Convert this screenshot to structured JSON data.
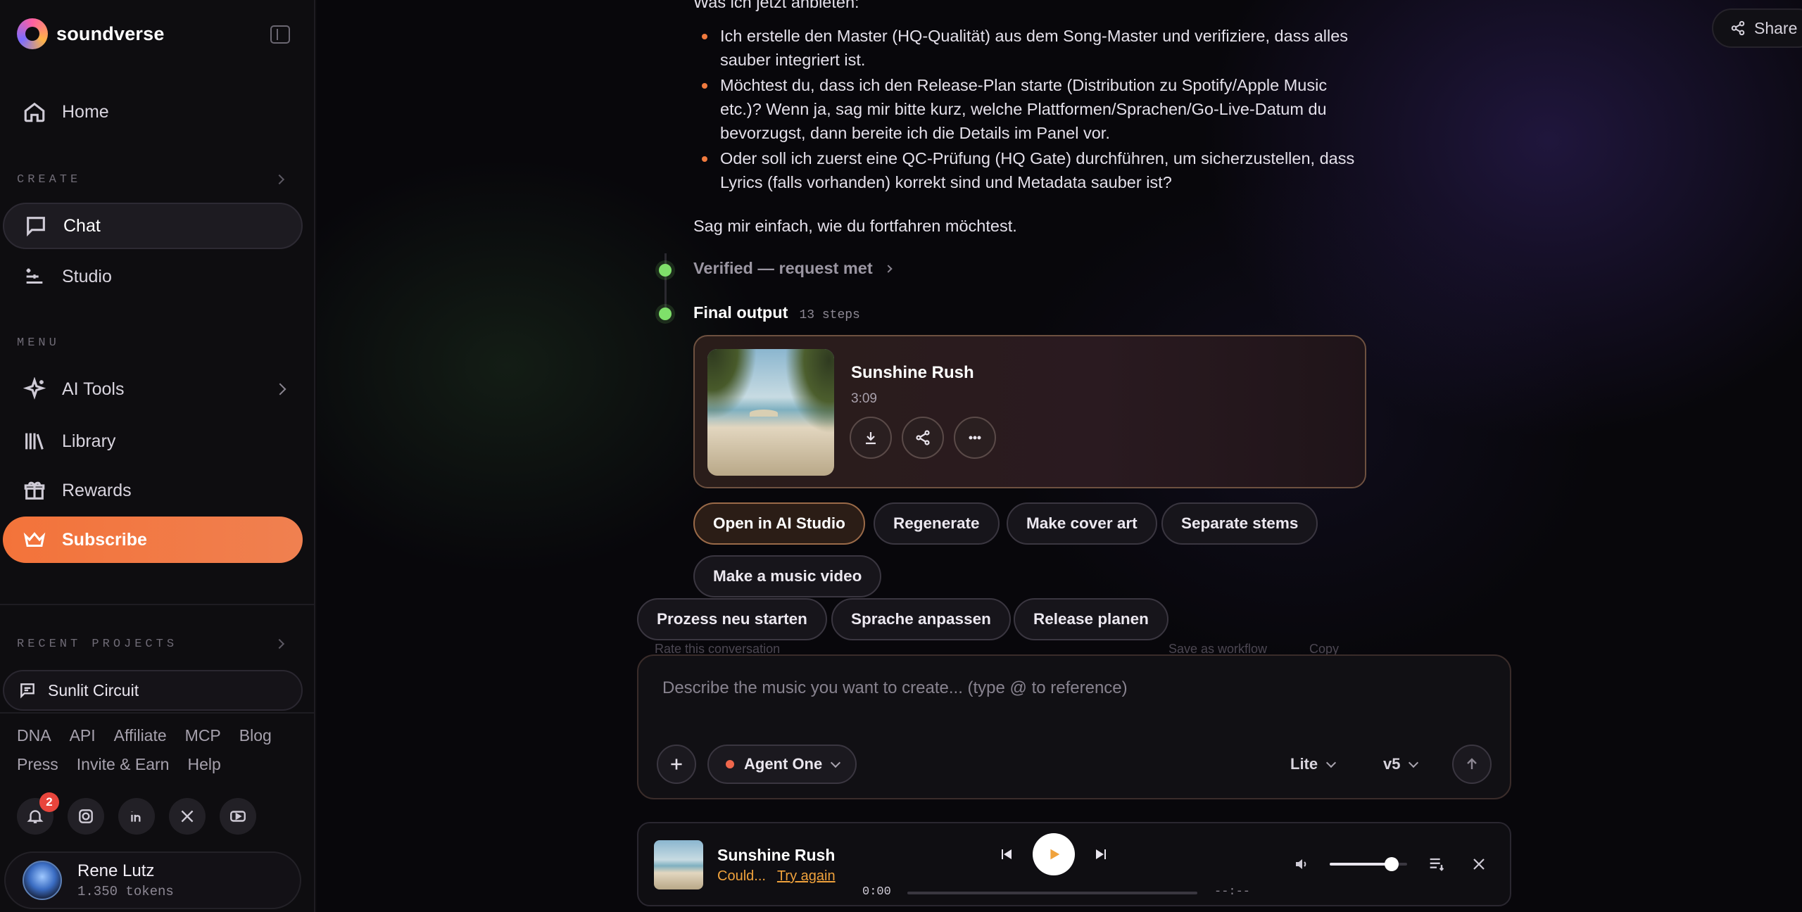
{
  "app": {
    "name": "soundverse"
  },
  "sidebar": {
    "home_label": "Home",
    "create_section": "CREATE",
    "chat_label": "Chat",
    "studio_label": "Studio",
    "menu_section": "MENU",
    "ai_tools_label": "AI Tools",
    "library_label": "Library",
    "rewards_label": "Rewards",
    "subscribe_label": "Subscribe",
    "recent_section": "RECENT PROJECTS",
    "recent_projects": [
      "Sunlit Circuit"
    ],
    "footer_links": [
      "DNA",
      "API",
      "Affiliate",
      "MCP",
      "Blog",
      "Press",
      "Invite & Earn",
      "Help"
    ],
    "notification_count": "2",
    "social_icons": [
      "bell-icon",
      "instagram-icon",
      "linkedin-icon",
      "x-icon",
      "youtube-icon"
    ],
    "user": {
      "name": "Rene Lutz",
      "tokens": "1.350 tokens"
    }
  },
  "header": {
    "share_label": "Share"
  },
  "conversation": {
    "intro_partial": "Was ich jetzt anbieten:",
    "bullets": [
      "Ich erstelle den Master (HQ-Qualität) aus dem Song-Master und verifiziere, dass alles sauber integriert ist.",
      "Möchtest du, dass ich den Release-Plan starte (Distribution zu Spotify/Apple Music etc.)? Wenn ja, sag mir bitte kurz, welche Plattformen/Sprachen/Go-Live-Datum du bevorzugst, dann bereite ich die Details im Panel vor.",
      "Oder soll ich zuerst eine QC-Prüfung (HQ Gate) durchführen, um sicherzustellen, dass Lyrics (falls vorhanden) korrekt sind und Metadata sauber ist?"
    ],
    "closing": "Sag mir einfach, wie du fortfahren möchtest.",
    "step_verified": "Verified — request met",
    "final_output_label": "Final output",
    "final_output_steps": "13 steps"
  },
  "output_card": {
    "title": "Sunshine Rush",
    "duration": "3:09"
  },
  "action_chips": [
    "Open in AI Studio",
    "Regenerate",
    "Make cover art",
    "Separate stems",
    "Make a music video"
  ],
  "suggestion_chips": [
    "Prozess neu starten",
    "Sprache anpassen",
    "Release planen"
  ],
  "faded_row": {
    "rate": "Rate this conversation",
    "save_workflow": "Save as workflow",
    "copy": "Copy"
  },
  "composer": {
    "placeholder": "Describe the music you want to create... (type @ to reference)",
    "agent_label": "Agent One",
    "quality_label": "Lite",
    "model_label": "v5"
  },
  "player": {
    "title": "Sunshine Rush",
    "status": "Could...",
    "retry_label": "Try again",
    "time_current": "0:00",
    "time_total": "--:--",
    "progress": 0,
    "volume": 0.8
  },
  "colors": {
    "accent": "#f07a3e",
    "step_dot": "#7fe06a",
    "warning": "#f0a23c"
  }
}
